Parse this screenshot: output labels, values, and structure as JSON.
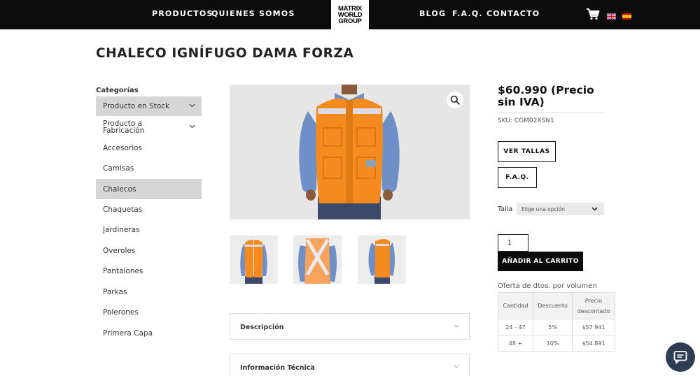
{
  "nav": {
    "left": [
      "PRODUCTOS",
      "QUIENES SOMOS"
    ],
    "right": [
      "BLOG",
      "F.A.Q.",
      "CONTACTO"
    ],
    "logo_lines": [
      "MATRIX",
      "WORLD",
      "GROUP"
    ]
  },
  "page_title": "CHALECO IGNÍFUGO DAMA FORZA",
  "sidebar": {
    "heading": "Categorías",
    "items": [
      {
        "label": "Producto en Stock",
        "active": true,
        "expandable": true
      },
      {
        "label": "Producto a Fabricación",
        "active": false,
        "expandable": true
      },
      {
        "label": "Accesorios",
        "active": false,
        "expandable": false
      },
      {
        "label": "Camisas",
        "active": false,
        "expandable": false
      },
      {
        "label": "Chalecos",
        "active": true,
        "expandable": false
      },
      {
        "label": "Chaquetas",
        "active": false,
        "expandable": false
      },
      {
        "label": "Jardineras",
        "active": false,
        "expandable": false
      },
      {
        "label": "Overoles",
        "active": false,
        "expandable": false
      },
      {
        "label": "Pantalones",
        "active": false,
        "expandable": false
      },
      {
        "label": "Parkas",
        "active": false,
        "expandable": false
      },
      {
        "label": "Polerones",
        "active": false,
        "expandable": false
      },
      {
        "label": "Primera Capa",
        "active": false,
        "expandable": false
      }
    ]
  },
  "accordion": [
    {
      "label": "Descripción"
    },
    {
      "label": "Información Técnica"
    }
  ],
  "product": {
    "price": "$60.990 (Precio sin IVA)",
    "sku": "SKU: CGM02XSN1",
    "ver_tallas": "VER TALLAS",
    "faq": "F.A.Q.",
    "talla_label": "Talla",
    "talla_placeholder": "Elige una opción",
    "quantity": "1",
    "add_to_cart": "AÑADIR AL CARRITO"
  },
  "volume_offer": {
    "title": "Oferta de dtos. por volumen",
    "headers": [
      "Cantidad",
      "Descuento",
      "Precio descontado"
    ],
    "rows": [
      [
        "24 - 47",
        "5%",
        "$57.941"
      ],
      [
        "48 +",
        "10%",
        "$54.891"
      ]
    ]
  },
  "colors": {
    "header_bg": "#0c0c0c",
    "vest_orange": "#f58a1e",
    "shirt_blue": "#6f8fc9",
    "chat_button": "#2e3d52"
  }
}
